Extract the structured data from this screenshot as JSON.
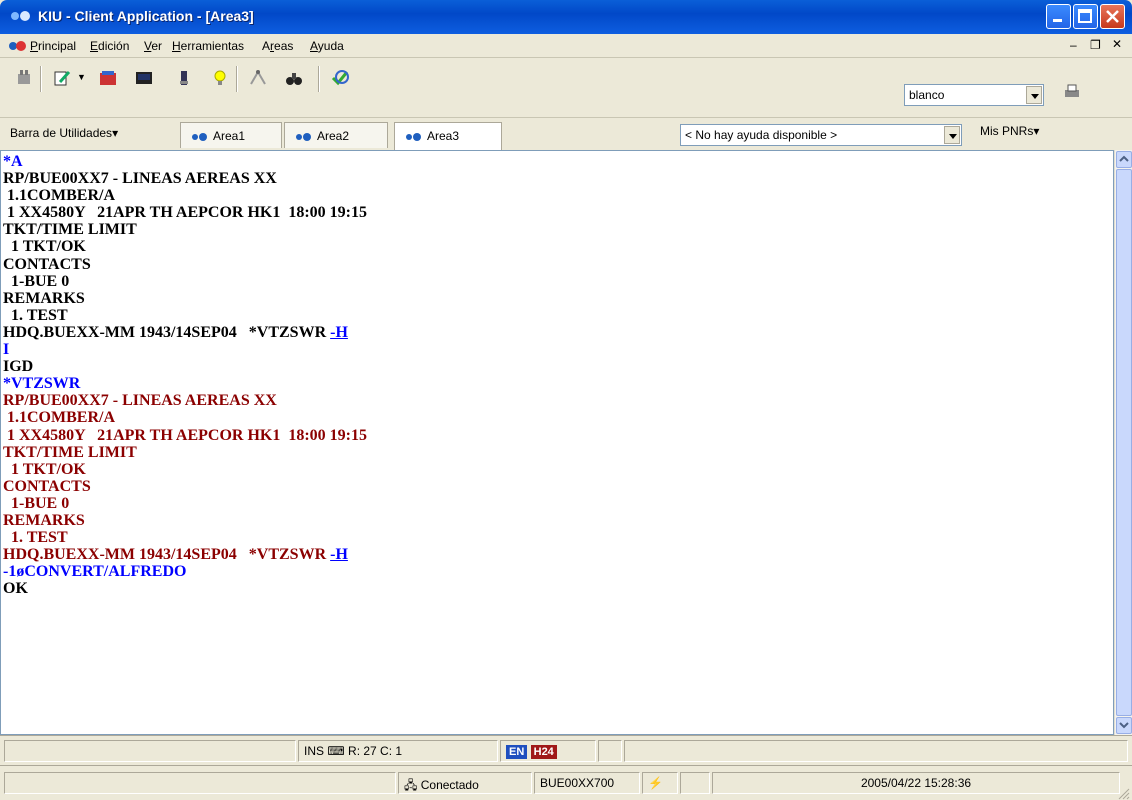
{
  "window": {
    "title": "KIU  -  Client Application - [Area3]",
    "accent": "#0148c8"
  },
  "menu": {
    "items": [
      {
        "label": "Principal",
        "underline": "P"
      },
      {
        "label": "Edición",
        "underline": "E"
      },
      {
        "label": "Ver",
        "underline": "V"
      },
      {
        "label": "Herramientas",
        "underline": "H"
      },
      {
        "label": "Areas",
        "underline": "r"
      },
      {
        "label": "Ayuda",
        "underline": "A"
      }
    ]
  },
  "toolbar": {
    "profile_value": "blanco",
    "help_value": "< No hay ayuda disponible >"
  },
  "tabs": {
    "utilities_label": "Barra de Utilidades",
    "areas": [
      "Area1",
      "Area2",
      "Area3"
    ],
    "active": "Area3",
    "my_pnrs_label": "Mis PNRs"
  },
  "terminal": {
    "lines": [
      {
        "text": "*A",
        "color": "blue"
      },
      {
        "text": "RP/BUE00XX7 - LINEAS AEREAS XX",
        "color": "black"
      },
      {
        "text": " 1.1COMBER/A",
        "color": "black"
      },
      {
        "text": " 1 XX4580Y   21APR TH AEPCOR HK1  18:00 19:15",
        "color": "black"
      },
      {
        "text": "TKT/TIME LIMIT",
        "color": "black"
      },
      {
        "text": "  1 TKT/OK",
        "color": "black"
      },
      {
        "text": "CONTACTS",
        "color": "black"
      },
      {
        "text": "  1-BUE 0",
        "color": "black"
      },
      {
        "text": "REMARKS",
        "color": "black"
      },
      {
        "text": "  1. TEST",
        "color": "black"
      },
      {
        "text": "HDQ.BUEXX-MM 1943/14SEP04   *VTZSWR ",
        "color": "black",
        "link": "-H"
      },
      {
        "text": "I",
        "color": "blue"
      },
      {
        "text": "IGD",
        "color": "black"
      },
      {
        "text": "*VTZSWR",
        "color": "blue"
      },
      {
        "text": "RP/BUE00XX7 - LINEAS AEREAS XX",
        "color": "red"
      },
      {
        "text": " 1.1COMBER/A",
        "color": "red"
      },
      {
        "text": " 1 XX4580Y   21APR TH AEPCOR HK1  18:00 19:15",
        "color": "red"
      },
      {
        "text": "TKT/TIME LIMIT",
        "color": "red"
      },
      {
        "text": "  1 TKT/OK",
        "color": "red"
      },
      {
        "text": "CONTACTS",
        "color": "red"
      },
      {
        "text": "  1-BUE 0",
        "color": "red"
      },
      {
        "text": "REMARKS",
        "color": "red"
      },
      {
        "text": "  1. TEST",
        "color": "red"
      },
      {
        "text": "HDQ.BUEXX-MM 1943/14SEP04   *VTZSWR ",
        "color": "red",
        "link": "-H"
      },
      {
        "text": "-1øCONVERT/ALFREDO",
        "color": "blue"
      },
      {
        "text": "OK",
        "color": "black"
      }
    ]
  },
  "status_bar_1": {
    "mode": "INS",
    "cursor": "R: 27 C:  1",
    "lang": "EN",
    "clock_mode": "H24"
  },
  "status_bar_2": {
    "connection": "Conectado",
    "pnr_code": "BUE00XX700",
    "datetime": "2005/04/22 15:28:36"
  }
}
